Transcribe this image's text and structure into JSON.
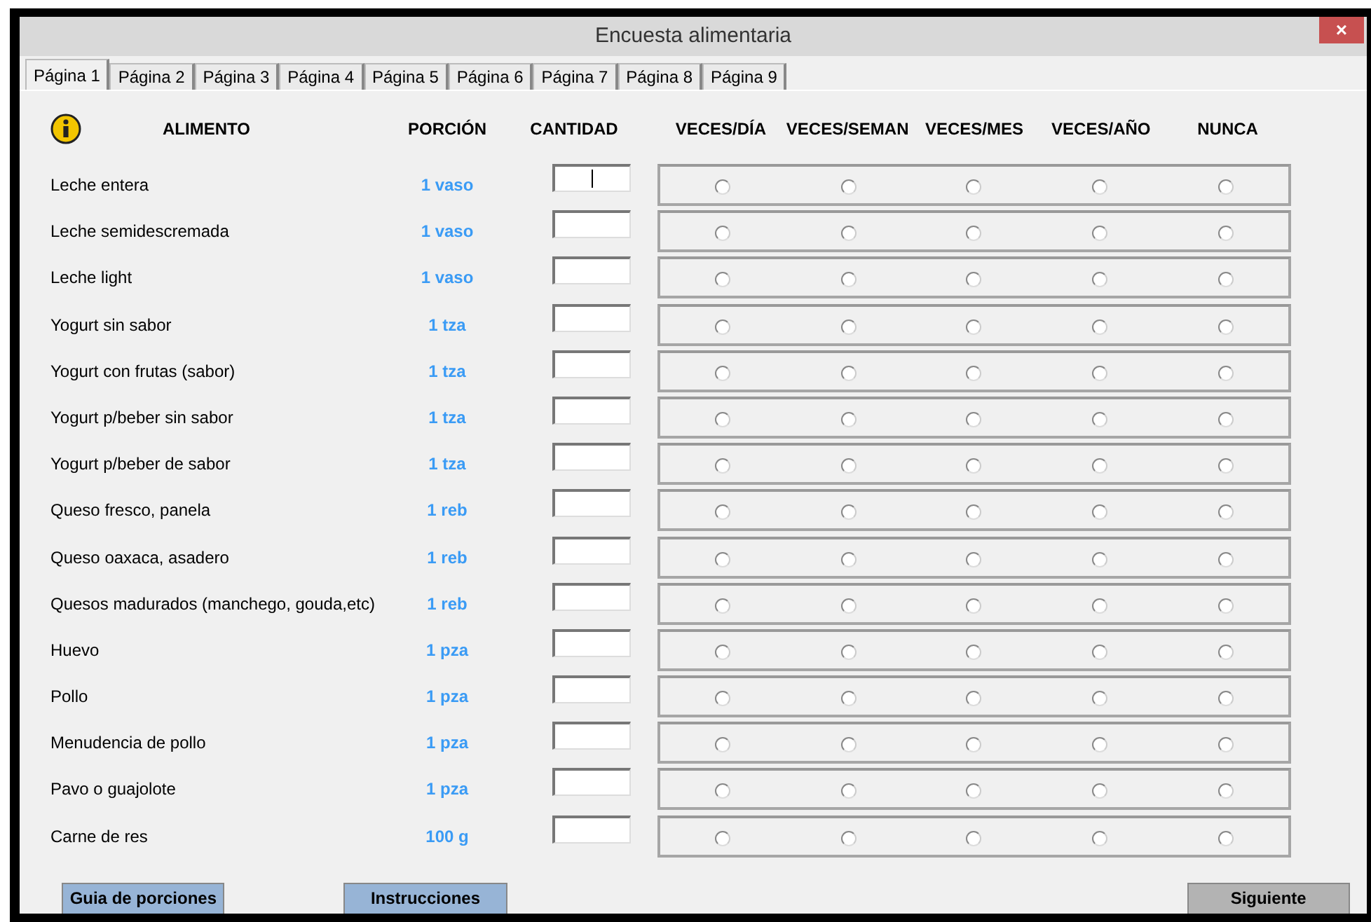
{
  "window": {
    "title": "Encuesta alimentaria",
    "close": "×"
  },
  "tabs": [
    {
      "label": "Página 1",
      "selected": true
    },
    {
      "label": "Página 2",
      "selected": false
    },
    {
      "label": "Página 3",
      "selected": false
    },
    {
      "label": "Página 4",
      "selected": false
    },
    {
      "label": "Página 5",
      "selected": false
    },
    {
      "label": "Página 6",
      "selected": false
    },
    {
      "label": "Página 7",
      "selected": false
    },
    {
      "label": "Página 8",
      "selected": false
    },
    {
      "label": "Página 9",
      "selected": false
    }
  ],
  "columns": {
    "food": "ALIMENTO",
    "portion": "PORCIÓN",
    "quantity": "CANTIDAD",
    "frequencies": [
      "VECES/DÍA",
      "VECES/SEMAN",
      "VECES/MES",
      "VECES/AÑO",
      "NUNCA"
    ]
  },
  "rows": [
    {
      "food": "Leche entera",
      "portion": "1 vaso",
      "focused": true,
      "selected": [
        false,
        false,
        false,
        false,
        false
      ]
    },
    {
      "food": "Leche semidescremada",
      "portion": "1 vaso",
      "focused": false,
      "selected": [
        false,
        false,
        false,
        false,
        false
      ]
    },
    {
      "food": "Leche light",
      "portion": "1 vaso",
      "focused": false,
      "selected": [
        false,
        false,
        false,
        false,
        false
      ]
    },
    {
      "food": "Yogurt sin sabor",
      "portion": "1 tza",
      "focused": false,
      "selected": [
        false,
        false,
        false,
        false,
        false
      ]
    },
    {
      "food": "Yogurt con frutas (sabor)",
      "portion": "1 tza",
      "focused": false,
      "selected": [
        false,
        false,
        false,
        false,
        false
      ]
    },
    {
      "food": "Yogurt p/beber sin sabor",
      "portion": "1 tza",
      "focused": false,
      "selected": [
        false,
        false,
        false,
        false,
        false
      ]
    },
    {
      "food": "Yogurt p/beber de sabor",
      "portion": "1 tza",
      "focused": false,
      "selected": [
        false,
        false,
        false,
        false,
        false
      ]
    },
    {
      "food": "Queso fresco, panela",
      "portion": "1 reb",
      "focused": false,
      "selected": [
        false,
        false,
        false,
        false,
        false
      ]
    },
    {
      "food": "Queso oaxaca, asadero",
      "portion": "1 reb",
      "focused": false,
      "selected": [
        false,
        false,
        false,
        false,
        false
      ]
    },
    {
      "food": "Quesos madurados (manchego, gouda,etc)",
      "portion": "1 reb",
      "focused": false,
      "selected": [
        false,
        false,
        false,
        false,
        false
      ]
    },
    {
      "food": "Huevo",
      "portion": "1 pza",
      "focused": false,
      "selected": [
        false,
        false,
        false,
        false,
        false
      ]
    },
    {
      "food": "Pollo",
      "portion": "1 pza",
      "focused": false,
      "selected": [
        false,
        false,
        false,
        false,
        false
      ]
    },
    {
      "food": "Menudencia de pollo",
      "portion": "1 pza",
      "focused": false,
      "selected": [
        false,
        false,
        false,
        false,
        false
      ]
    },
    {
      "food": "Pavo o guajolote",
      "portion": "1 pza",
      "focused": false,
      "selected": [
        false,
        false,
        false,
        false,
        false
      ]
    },
    {
      "food": "Carne de res",
      "portion": "100 g",
      "focused": false,
      "selected": [
        false,
        false,
        false,
        false,
        false
      ]
    }
  ],
  "buttons": [
    {
      "label": "Guia de porciones",
      "kind": "blue"
    },
    {
      "label": "Instrucciones",
      "kind": "blue"
    },
    {
      "label": "Siguiente",
      "kind": "grey"
    }
  ]
}
